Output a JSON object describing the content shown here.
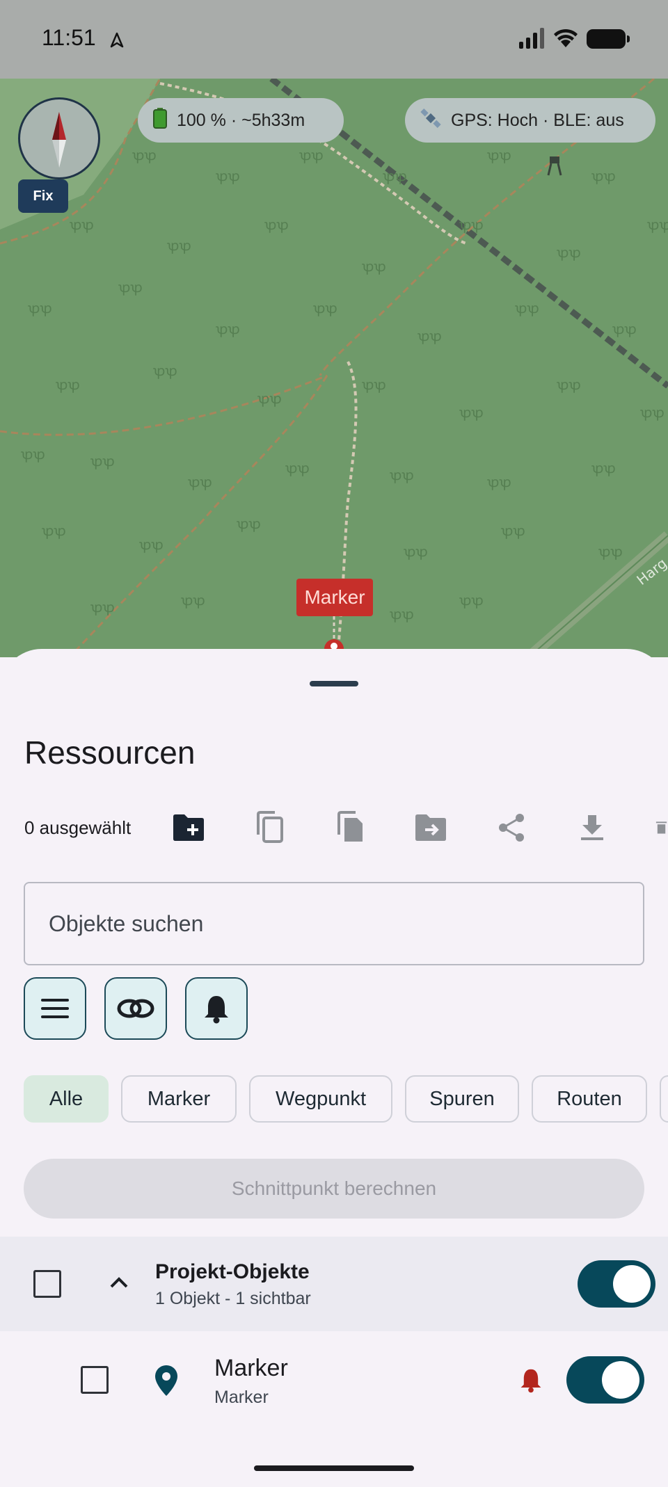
{
  "status_bar": {
    "time": "11:51"
  },
  "map": {
    "battery_pill": "100 % · ~5h33m",
    "gps_pill": "GPS: Hoch · BLE: aus",
    "fix_label": "Fix",
    "marker_label": "Marker",
    "road_label": "Harg"
  },
  "sheet": {
    "title": "Ressourcen",
    "selected_count": "0 ausgewählt",
    "toolbar_icons": [
      "folder-add-icon",
      "copy-icon",
      "paste-icon",
      "move-to-folder-icon",
      "share-icon",
      "download-icon",
      "delete-icon"
    ],
    "search_placeholder": "Objekte suchen",
    "icon_buttons": [
      "menu-icon",
      "visibility-icon",
      "bell-icon"
    ],
    "chips": [
      "Alle",
      "Marker",
      "Wegpunkt",
      "Spuren",
      "Routen"
    ],
    "active_chip": "Alle",
    "calc_button": "Schnittpunkt berechnen"
  },
  "group": {
    "title": "Projekt-Objekte",
    "subtitle": "1 Objekt - 1 sichtbar",
    "visible": true
  },
  "items": [
    {
      "title": "Marker",
      "subtitle": "Marker",
      "alarm": true,
      "visible": true
    }
  ],
  "colors": {
    "accent": "#07485a",
    "marker_red": "#c62f2a",
    "alarm_red": "#b3261e",
    "map_green": "#6f9a6a"
  }
}
